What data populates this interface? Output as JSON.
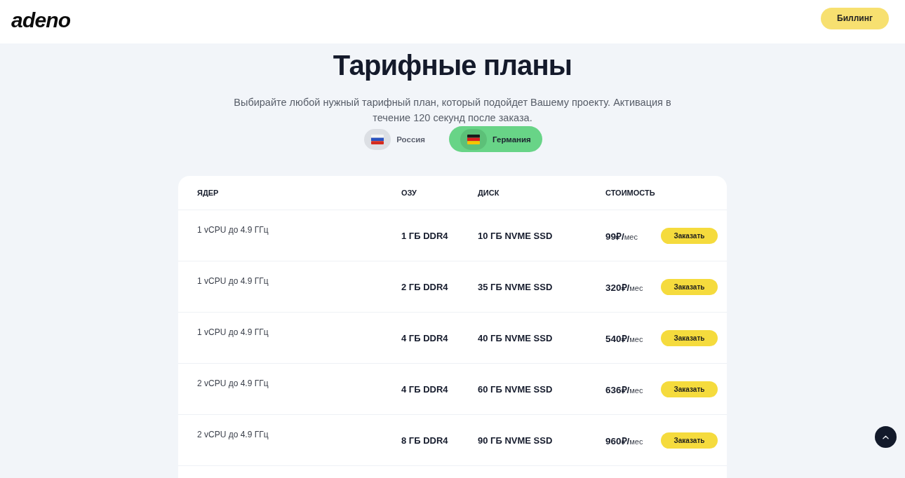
{
  "header": {
    "logo": "adeno",
    "billing_button": "Биллинг"
  },
  "pricing": {
    "title": "Тарифные планы",
    "subtitle": "Выбирайте любой нужный тарифный план, который подойдет Вашему проекту. Активация в течение 120 секунд после заказа.",
    "countries": [
      {
        "label": "Россия",
        "selected": false
      },
      {
        "label": "Германия",
        "selected": true
      }
    ]
  },
  "table": {
    "columns": [
      "ЯДЕР",
      "ОЗУ",
      "ДИСК",
      "СТОИМОСТЬ"
    ],
    "rows": [
      {
        "cores": "1 vCPU до 4.9 ГГц",
        "ram": "1 ГБ DDR4",
        "disk": "10 ГБ NVME SSD",
        "price": "99₽/",
        "unit": "мес",
        "button": "Заказать"
      },
      {
        "cores": "1 vCPU до 4.9 ГГц",
        "ram": "2 ГБ DDR4",
        "disk": "35 ГБ NVME SSD",
        "price": "320₽/",
        "unit": "мес",
        "button": "Заказать"
      },
      {
        "cores": "1 vCPU до 4.9 ГГц",
        "ram": "4 ГБ DDR4",
        "disk": "40 ГБ NVME SSD",
        "price": "540₽/",
        "unit": "мес",
        "button": "Заказать"
      },
      {
        "cores": "2 vCPU до 4.9 ГГц",
        "ram": "4 ГБ DDR4",
        "disk": "60 ГБ NVME SSD",
        "price": "636₽/",
        "unit": "мес",
        "button": "Заказать"
      },
      {
        "cores": "2 vCPU до 4.9 ГГц",
        "ram": "8 ГБ DDR4",
        "disk": "90 ГБ NVME SSD",
        "price": "960₽/",
        "unit": "мес",
        "button": "Заказать"
      }
    ]
  }
}
